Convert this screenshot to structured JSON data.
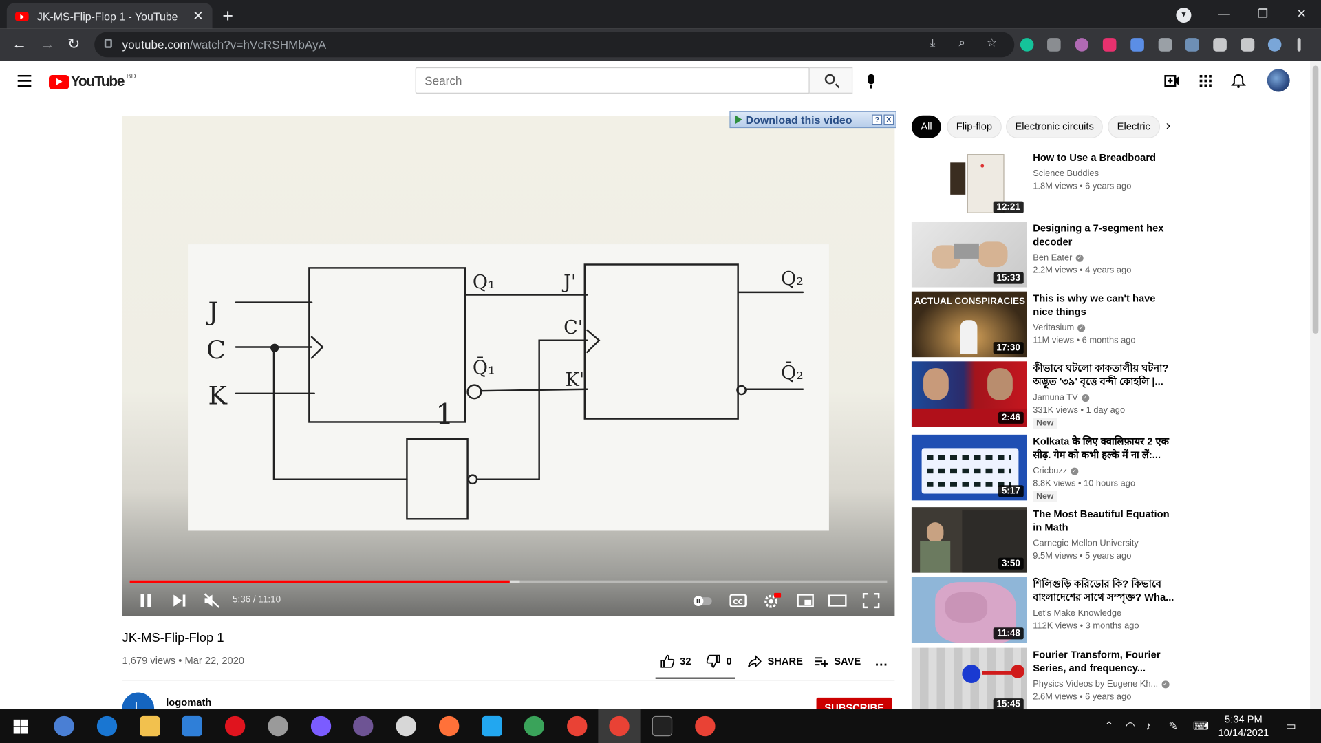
{
  "browser": {
    "tab_title": "JK-MS-Flip-Flop 1 - YouTube",
    "tab_close": "✕",
    "new_tab": "+",
    "url_host": "youtube.com",
    "url_path": "/watch?v=hVcRSHMbAyA",
    "window_controls": [
      "—",
      "❐",
      "✕"
    ]
  },
  "header": {
    "logo_text": "YouTube",
    "region": "BD",
    "search_placeholder": "Search"
  },
  "player": {
    "download_bar": "Download this video",
    "download_help": "?",
    "download_close": "X",
    "time": "5:36 / 11:10",
    "progress_played": 0.5015,
    "progress_buffered": 0.515
  },
  "video": {
    "title": "JK-MS-Flip-Flop 1",
    "meta": "1,679 views • Mar 22, 2020",
    "likes": "32",
    "dislikes": "0",
    "share": "SHARE",
    "save": "SAVE",
    "more": "…",
    "channel_initial": "L",
    "channel_name": "logomath",
    "subscribe": "SUBSCRIBE"
  },
  "chips": [
    "All",
    "Flip-flop",
    "Electronic circuits",
    "Electric"
  ],
  "recommendations": [
    {
      "title": "How to Use a Breadboard",
      "channel": "Science Buddies",
      "verified": false,
      "meta": "1.8M views • 6 years ago",
      "duration": "12:21",
      "new": ""
    },
    {
      "title": "Designing a 7-segment hex decoder",
      "channel": "Ben Eater",
      "verified": true,
      "meta": "2.2M views • 4 years ago",
      "duration": "15:33",
      "new": ""
    },
    {
      "title": "This is why we can't have nice things",
      "channel": "Veritasium",
      "verified": true,
      "meta": "11M views • 6 months ago",
      "duration": "17:30",
      "new": ""
    },
    {
      "title": "কীভাবে ঘটলো কাকতালীয় ঘটনা? অদ্ভুত '৩৯' বৃত্তে বন্দী কোহলি |...",
      "channel": "Jamuna TV",
      "verified": true,
      "meta": "331K views • 1 day ago",
      "duration": "2:46",
      "new": "New"
    },
    {
      "title": "Kolkata के लिए क्वालिफ़ायर 2 एक सीढ़. गेम को कभी हल्के में ना लें:...",
      "channel": "Cricbuzz",
      "verified": true,
      "meta": "8.8K views • 10 hours ago",
      "duration": "5:17",
      "new": "New"
    },
    {
      "title": "The Most Beautiful Equation in Math",
      "channel": "Carnegie Mellon University",
      "verified": false,
      "meta": "9.5M views • 5 years ago",
      "duration": "3:50",
      "new": ""
    },
    {
      "title": "শিলিগুড়ি করিডোর কি? কিভাবে বাংলাদেশের সাথে সম্পৃক্ত? Wha...",
      "channel": "Let's Make Knowledge",
      "verified": false,
      "meta": "112K views • 3 months ago",
      "duration": "11:48",
      "new": ""
    },
    {
      "title": "Fourier Transform, Fourier Series, and frequency...",
      "channel": "Physics Videos by Eugene Kh...",
      "verified": true,
      "meta": "2.6M views • 6 years ago",
      "duration": "15:45",
      "new": ""
    }
  ],
  "thumb_text": {
    "conspiracy": "ACTUAL CONSPIRACIES"
  },
  "diagram_labels": {
    "j": "J",
    "c": "C",
    "k": "K",
    "q1": "Q₁",
    "q1bar": "Q̄₁",
    "j2": "J'",
    "c2": "C'",
    "k2": "K'",
    "q2": "Q₂",
    "q2bar": "Q̄₂",
    "inv": "1"
  },
  "taskbar": {
    "time": "5:34 PM",
    "date": "10/14/2021"
  },
  "colors": {
    "youtube_red": "#ff0000",
    "progress_red": "#ff0000",
    "subscribe_red": "#cc0000",
    "chrome_dark": "#202124"
  }
}
